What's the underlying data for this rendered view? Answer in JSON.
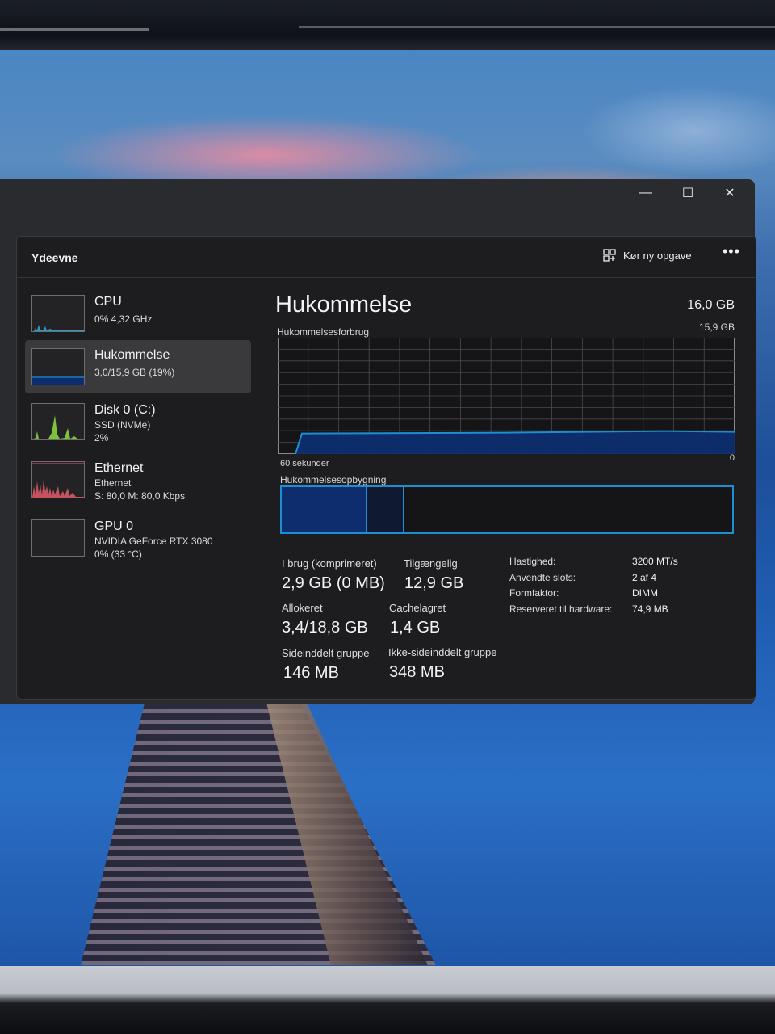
{
  "app": {
    "page_title": "Ydeevne",
    "run_task_label": "Kør ny opgave",
    "more_label": "•••"
  },
  "window_controls": {
    "minimize": "—",
    "maximize": "☐",
    "close": "✕"
  },
  "sidebar": {
    "items": [
      {
        "name": "CPU",
        "line1": "0% 4,32 GHz",
        "line2": ""
      },
      {
        "name": "Hukommelse",
        "line1": "3,0/15,9 GB (19%)",
        "line2": ""
      },
      {
        "name": "Disk 0 (C:)",
        "line1": "SSD (NVMe)",
        "line2": "2%"
      },
      {
        "name": "Ethernet",
        "line1": "Ethernet",
        "line2": "S: 80,0 M: 80,0 Kbps"
      },
      {
        "name": "GPU 0",
        "line1": "NVIDIA GeForce RTX 3080",
        "line2": "0% (33 °C)"
      }
    ]
  },
  "memory": {
    "title": "Hukommelse",
    "total": "16,0 GB",
    "usage_chart_label": "Hukommelsesforbrug",
    "usage_chart_max": "15,9 GB",
    "axis_left": "60 sekunder",
    "axis_right": "0",
    "composition_label": "Hukommelsesopbygning",
    "usage_fraction": 0.19,
    "stats": {
      "in_use_label": "I brug (komprimeret)",
      "in_use_value": "2,9 GB (0 MB)",
      "available_label": "Tilgængelig",
      "available_value": "12,9 GB",
      "committed_label": "Allokeret",
      "committed_value": "3,4/18,8 GB",
      "cached_label": "Cachelagret",
      "cached_value": "1,4 GB",
      "paged_label": "Sideinddelt gruppe",
      "paged_value": "146 MB",
      "nonpaged_label": "Ikke-sideinddelt gruppe",
      "nonpaged_value": "348 MB"
    },
    "specs": {
      "speed_label": "Hastighed:",
      "speed_value": "3200 MT/s",
      "slots_label": "Anvendte slots:",
      "slots_value": "2 af 4",
      "form_label": "Formfaktor:",
      "form_value": "DIMM",
      "reserved_label": "Reserveret til hardware:",
      "reserved_value": "74,9 MB"
    }
  },
  "colors": {
    "accent": "#1d8fd1",
    "fill": "#0d2d6f",
    "cpu_graph": "#2aa8e0",
    "disk_graph": "#7cc33a",
    "net_graph": "#e05a6a"
  }
}
